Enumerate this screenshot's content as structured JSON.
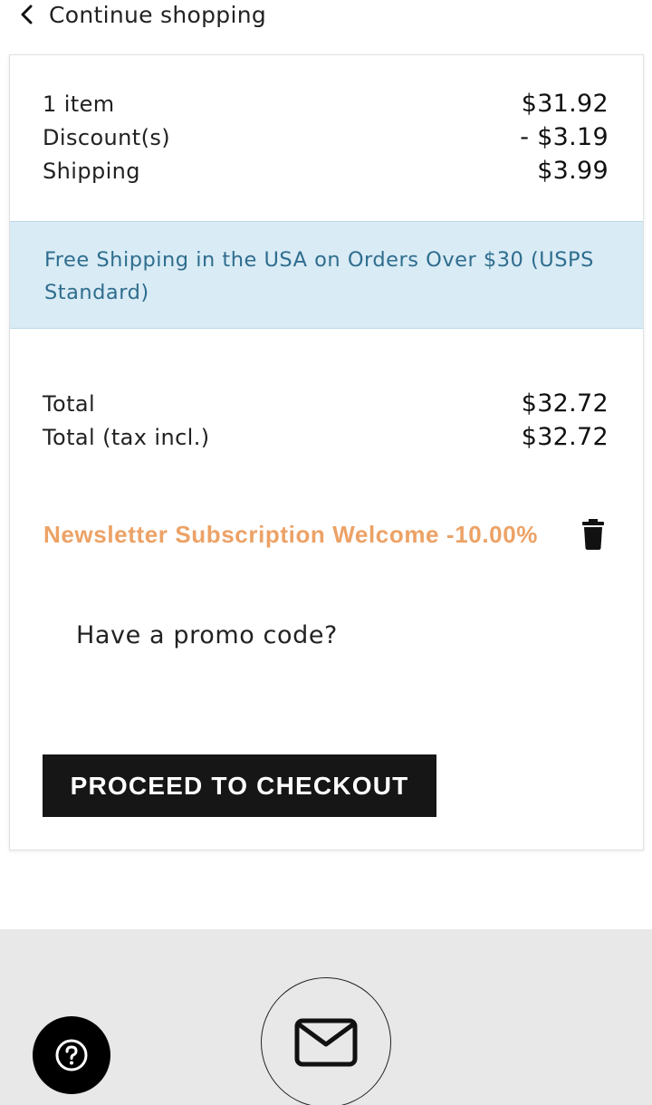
{
  "nav": {
    "continue_label": "Continue shopping",
    "icon": "chevron-left-icon"
  },
  "summary": {
    "items_label": "1 item",
    "items_value": "$31.92",
    "discount_label": "Discount(s)",
    "discount_value": "- $3.19",
    "shipping_label": "Shipping",
    "shipping_value": "$3.99",
    "banner_text": "Free Shipping in the USA on Orders Over $30 (USPS Standard)",
    "total_label": "Total",
    "total_value": "$32.72",
    "total_tax_label": "Total (tax incl.)",
    "total_tax_value": "$32.72"
  },
  "voucher": {
    "name": "Newsletter Subscription Welcome -10.00%",
    "remove_icon": "trash-icon"
  },
  "promo": {
    "label": "Have a promo code?"
  },
  "checkout": {
    "label": "PROCEED TO CHECKOUT"
  },
  "footer": {
    "help_icon": "help-icon",
    "mail_icon": "mail-icon"
  },
  "colors": {
    "banner_bg": "#d9ebf5",
    "banner_text": "#2e6d8e",
    "voucher_text": "#eca266",
    "button_bg": "#161616",
    "footer_bg": "#e8e8e8"
  }
}
